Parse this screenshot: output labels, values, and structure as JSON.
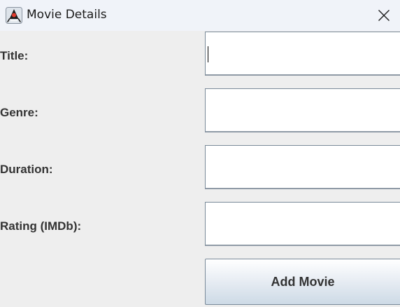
{
  "window": {
    "title": "Movie Details",
    "icon": "java-duke-icon",
    "close_icon": "close-icon"
  },
  "form": {
    "title_label": "Title:",
    "title_value": "",
    "genre_label": "Genre:",
    "genre_value": "",
    "duration_label": "Duration:",
    "duration_value": "",
    "rating_label": "Rating (IMDb):",
    "rating_value": ""
  },
  "actions": {
    "add_label": "Add Movie"
  },
  "colors": {
    "background": "#eeeeee",
    "titlebar": "#f0f3f9",
    "label_text": "#333333",
    "field_border": "#7a8a99"
  }
}
